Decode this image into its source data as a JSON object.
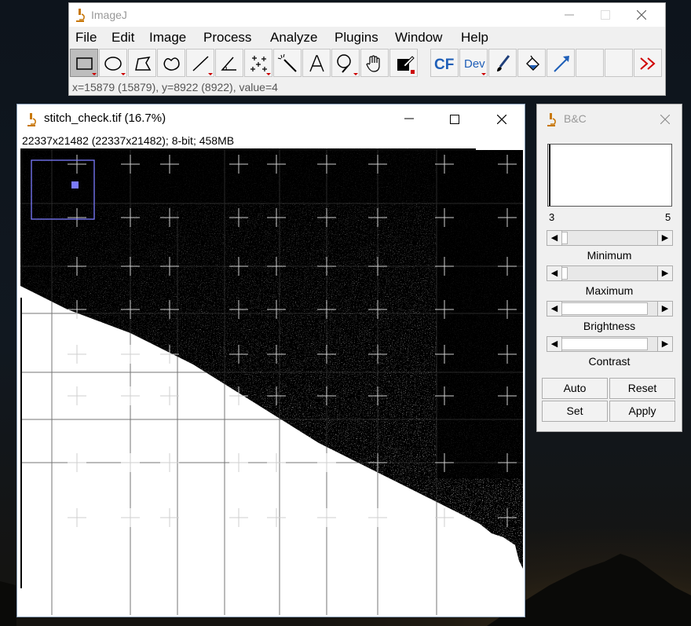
{
  "main_window": {
    "title": "ImageJ",
    "menus": [
      "File",
      "Edit",
      "Image",
      "Process",
      "Analyze",
      "Plugins",
      "Window",
      "Help"
    ],
    "tools": [
      {
        "icon": "rectangle-selection-icon",
        "selected": true
      },
      {
        "icon": "oval-selection-icon"
      },
      {
        "icon": "polygon-selection-icon"
      },
      {
        "icon": "freehand-selection-icon"
      },
      {
        "icon": "line-selection-icon"
      },
      {
        "icon": "angle-tool-icon"
      },
      {
        "icon": "multi-point-tool-icon"
      },
      {
        "icon": "wand-tool-icon"
      },
      {
        "icon": "text-tool-icon",
        "glyph": "A"
      },
      {
        "icon": "magnifying-glass-icon"
      },
      {
        "icon": "hand-scroll-icon"
      },
      {
        "icon": "color-picker-icon"
      },
      {
        "icon": "cf-tool-icon",
        "glyph": "CF"
      },
      {
        "icon": "dev-menu-icon",
        "glyph": "Dev"
      },
      {
        "icon": "brush-tool-icon"
      },
      {
        "icon": "flood-fill-icon"
      },
      {
        "icon": "arrow-tool-icon"
      },
      {
        "icon": "empty-slot"
      },
      {
        "icon": "empty-slot"
      },
      {
        "icon": "more-tools-icon",
        "glyph": "≫"
      }
    ],
    "status": "x=15879 (15879), y=8922 (8922), value=4"
  },
  "image_window": {
    "title": "stitch_check.tif (16.7%)",
    "info": "22337x21482   (22337x21482); 8-bit; 458MB"
  },
  "bc_window": {
    "title": "B&C",
    "histogram_min_label": "3",
    "histogram_max_label": "5",
    "sliders": [
      {
        "label": "Minimum",
        "value_fraction": 0.0
      },
      {
        "label": "Maximum",
        "value_fraction": 0.0
      },
      {
        "label": "Brightness",
        "value_fraction": 0.5
      },
      {
        "label": "Contrast",
        "value_fraction": 0.5
      }
    ],
    "buttons": {
      "auto": "Auto",
      "reset": "Reset",
      "set": "Set",
      "apply": "Apply"
    }
  },
  "colors": {
    "roi_outline": "#7b7bff",
    "more_tools": "#d00000",
    "cf_blue": "#1f5fb8"
  }
}
